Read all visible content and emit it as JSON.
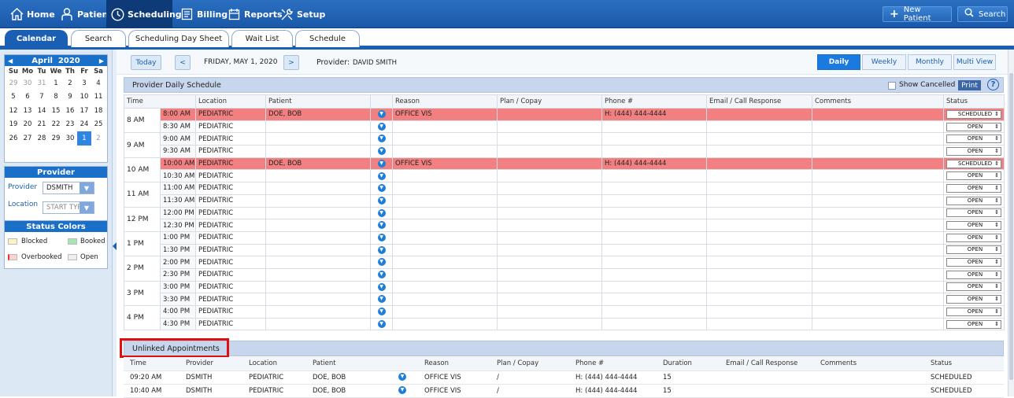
{
  "nav": {
    "home": "Home",
    "patient": "Patient",
    "scheduling": "Scheduling",
    "billing": "Billing",
    "reports": "Reports",
    "setup": "Setup",
    "new_patient": "New Patient",
    "search": "Search"
  },
  "tabs": [
    "Calendar",
    "Search",
    "Scheduling Day Sheet",
    "Wait List",
    "Schedule"
  ],
  "calendar": {
    "month_year": "April  2020",
    "dow": [
      "Su",
      "Mo",
      "Tu",
      "We",
      "Th",
      "Fr",
      "Sa"
    ],
    "weeks": [
      [
        "29",
        "30",
        "31",
        "1",
        "2",
        "3",
        "4"
      ],
      [
        "5",
        "6",
        "7",
        "8",
        "9",
        "10",
        "11"
      ],
      [
        "12",
        "13",
        "14",
        "15",
        "16",
        "17",
        "18"
      ],
      [
        "19",
        "20",
        "21",
        "22",
        "23",
        "24",
        "25"
      ],
      [
        "26",
        "27",
        "28",
        "29",
        "30",
        "1",
        "2"
      ]
    ],
    "selected": "1"
  },
  "provider_box": {
    "title": "Provider",
    "provider_label": "Provider",
    "provider_value": "DSMITH",
    "location_label": "Location",
    "location_placeholder": "START TYPIN"
  },
  "status_colors": {
    "title": "Status Colors",
    "blocked": "Blocked",
    "booked": "Booked",
    "overbooked": "Overbooked",
    "open": "Open",
    "colors": {
      "blocked": "#fbf3c4",
      "booked": "#a8e6b0",
      "overbooked": "#fbd3d3",
      "open": "#eeeeee"
    }
  },
  "toolbar": {
    "today": "Today",
    "prev": "<",
    "next": ">",
    "date": "FRIDAY, MAY 1, 2020",
    "provider_label": "Provider:",
    "provider_name": "DAVID SMITH",
    "views": [
      "Daily",
      "Weekly",
      "Monthly",
      "Multi View"
    ]
  },
  "schedule": {
    "title": "Provider Daily Schedule",
    "show_cancelled": "Show Cancelled",
    "print": "Print",
    "help": "?",
    "columns": [
      "Time",
      "",
      "Location",
      "Patient",
      "",
      "Reason",
      "Plan / Copay",
      "Phone #",
      "Email / Call Response",
      "Comments",
      "Status"
    ],
    "hours": [
      "8 AM",
      "9 AM",
      "10 AM",
      "11 AM",
      "12 PM",
      "1 PM",
      "2 PM",
      "3 PM",
      "4 PM"
    ],
    "rows": [
      {
        "time": "8:00 AM",
        "location": "PEDIATRIC",
        "patient": "DOE, BOB",
        "reason": "OFFICE VIS",
        "plan": "",
        "phone": "H: (444) 444-4444",
        "email": "",
        "comments": "",
        "status": "SCHEDULED",
        "booked": true
      },
      {
        "time": "8:30 AM",
        "location": "PEDIATRIC",
        "patient": "",
        "reason": "",
        "plan": "",
        "phone": "",
        "email": "",
        "comments": "",
        "status": "OPEN",
        "booked": false
      },
      {
        "time": "9:00 AM",
        "location": "PEDIATRIC",
        "patient": "",
        "reason": "",
        "plan": "",
        "phone": "",
        "email": "",
        "comments": "",
        "status": "OPEN",
        "booked": false
      },
      {
        "time": "9:30 AM",
        "location": "PEDIATRIC",
        "patient": "",
        "reason": "",
        "plan": "",
        "phone": "",
        "email": "",
        "comments": "",
        "status": "OPEN",
        "booked": false
      },
      {
        "time": "10:00 AM",
        "location": "PEDIATRIC",
        "patient": "DOE, BOB",
        "reason": "OFFICE VIS",
        "plan": "",
        "phone": "H: (444) 444-4444",
        "email": "",
        "comments": "",
        "status": "SCHEDULED",
        "booked": true
      },
      {
        "time": "10:30 AM",
        "location": "PEDIATRIC",
        "patient": "",
        "reason": "",
        "plan": "",
        "phone": "",
        "email": "",
        "comments": "",
        "status": "OPEN",
        "booked": false
      },
      {
        "time": "11:00 AM",
        "location": "PEDIATRIC",
        "patient": "",
        "reason": "",
        "plan": "",
        "phone": "",
        "email": "",
        "comments": "",
        "status": "OPEN",
        "booked": false
      },
      {
        "time": "11:30 AM",
        "location": "PEDIATRIC",
        "patient": "",
        "reason": "",
        "plan": "",
        "phone": "",
        "email": "",
        "comments": "",
        "status": "OPEN",
        "booked": false
      },
      {
        "time": "12:00 PM",
        "location": "PEDIATRIC",
        "patient": "",
        "reason": "",
        "plan": "",
        "phone": "",
        "email": "",
        "comments": "",
        "status": "OPEN",
        "booked": false
      },
      {
        "time": "12:30 PM",
        "location": "PEDIATRIC",
        "patient": "",
        "reason": "",
        "plan": "",
        "phone": "",
        "email": "",
        "comments": "",
        "status": "OPEN",
        "booked": false
      },
      {
        "time": "1:00 PM",
        "location": "PEDIATRIC",
        "patient": "",
        "reason": "",
        "plan": "",
        "phone": "",
        "email": "",
        "comments": "",
        "status": "OPEN",
        "booked": false
      },
      {
        "time": "1:30 PM",
        "location": "PEDIATRIC",
        "patient": "",
        "reason": "",
        "plan": "",
        "phone": "",
        "email": "",
        "comments": "",
        "status": "OPEN",
        "booked": false
      },
      {
        "time": "2:00 PM",
        "location": "PEDIATRIC",
        "patient": "",
        "reason": "",
        "plan": "",
        "phone": "",
        "email": "",
        "comments": "",
        "status": "OPEN",
        "booked": false
      },
      {
        "time": "2:30 PM",
        "location": "PEDIATRIC",
        "patient": "",
        "reason": "",
        "plan": "",
        "phone": "",
        "email": "",
        "comments": "",
        "status": "OPEN",
        "booked": false
      },
      {
        "time": "3:00 PM",
        "location": "PEDIATRIC",
        "patient": "",
        "reason": "",
        "plan": "",
        "phone": "",
        "email": "",
        "comments": "",
        "status": "OPEN",
        "booked": false
      },
      {
        "time": "3:30 PM",
        "location": "PEDIATRIC",
        "patient": "",
        "reason": "",
        "plan": "",
        "phone": "",
        "email": "",
        "comments": "",
        "status": "OPEN",
        "booked": false
      },
      {
        "time": "4:00 PM",
        "location": "PEDIATRIC",
        "patient": "",
        "reason": "",
        "plan": "",
        "phone": "",
        "email": "",
        "comments": "",
        "status": "OPEN",
        "booked": false
      },
      {
        "time": "4:30 PM",
        "location": "PEDIATRIC",
        "patient": "",
        "reason": "",
        "plan": "",
        "phone": "",
        "email": "",
        "comments": "",
        "status": "OPEN",
        "booked": false
      }
    ]
  },
  "unlinked": {
    "title": "Unlinked Appointments",
    "columns": [
      "Time",
      "Provider",
      "Location",
      "Patient",
      "",
      "Reason",
      "Plan / Copay",
      "Phone #",
      "Duration",
      "Email / Call Response",
      "Comments",
      "Status"
    ],
    "rows": [
      {
        "time": "09:20 AM",
        "provider": "DSMITH",
        "location": "PEDIATRIC",
        "patient": "DOE, BOB",
        "reason": "OFFICE VIS",
        "plan": "/",
        "phone": "H: (444) 444-4444",
        "duration": "15",
        "email": "",
        "comments": "",
        "status": "SCHEDULED"
      },
      {
        "time": "10:40 AM",
        "provider": "DSMITH",
        "location": "PEDIATRIC",
        "patient": "DOE, BOB",
        "reason": "OFFICE VIS",
        "plan": "/",
        "phone": "H: (444) 444-4444",
        "duration": "15",
        "email": "",
        "comments": "",
        "status": "SCHEDULED"
      }
    ]
  }
}
